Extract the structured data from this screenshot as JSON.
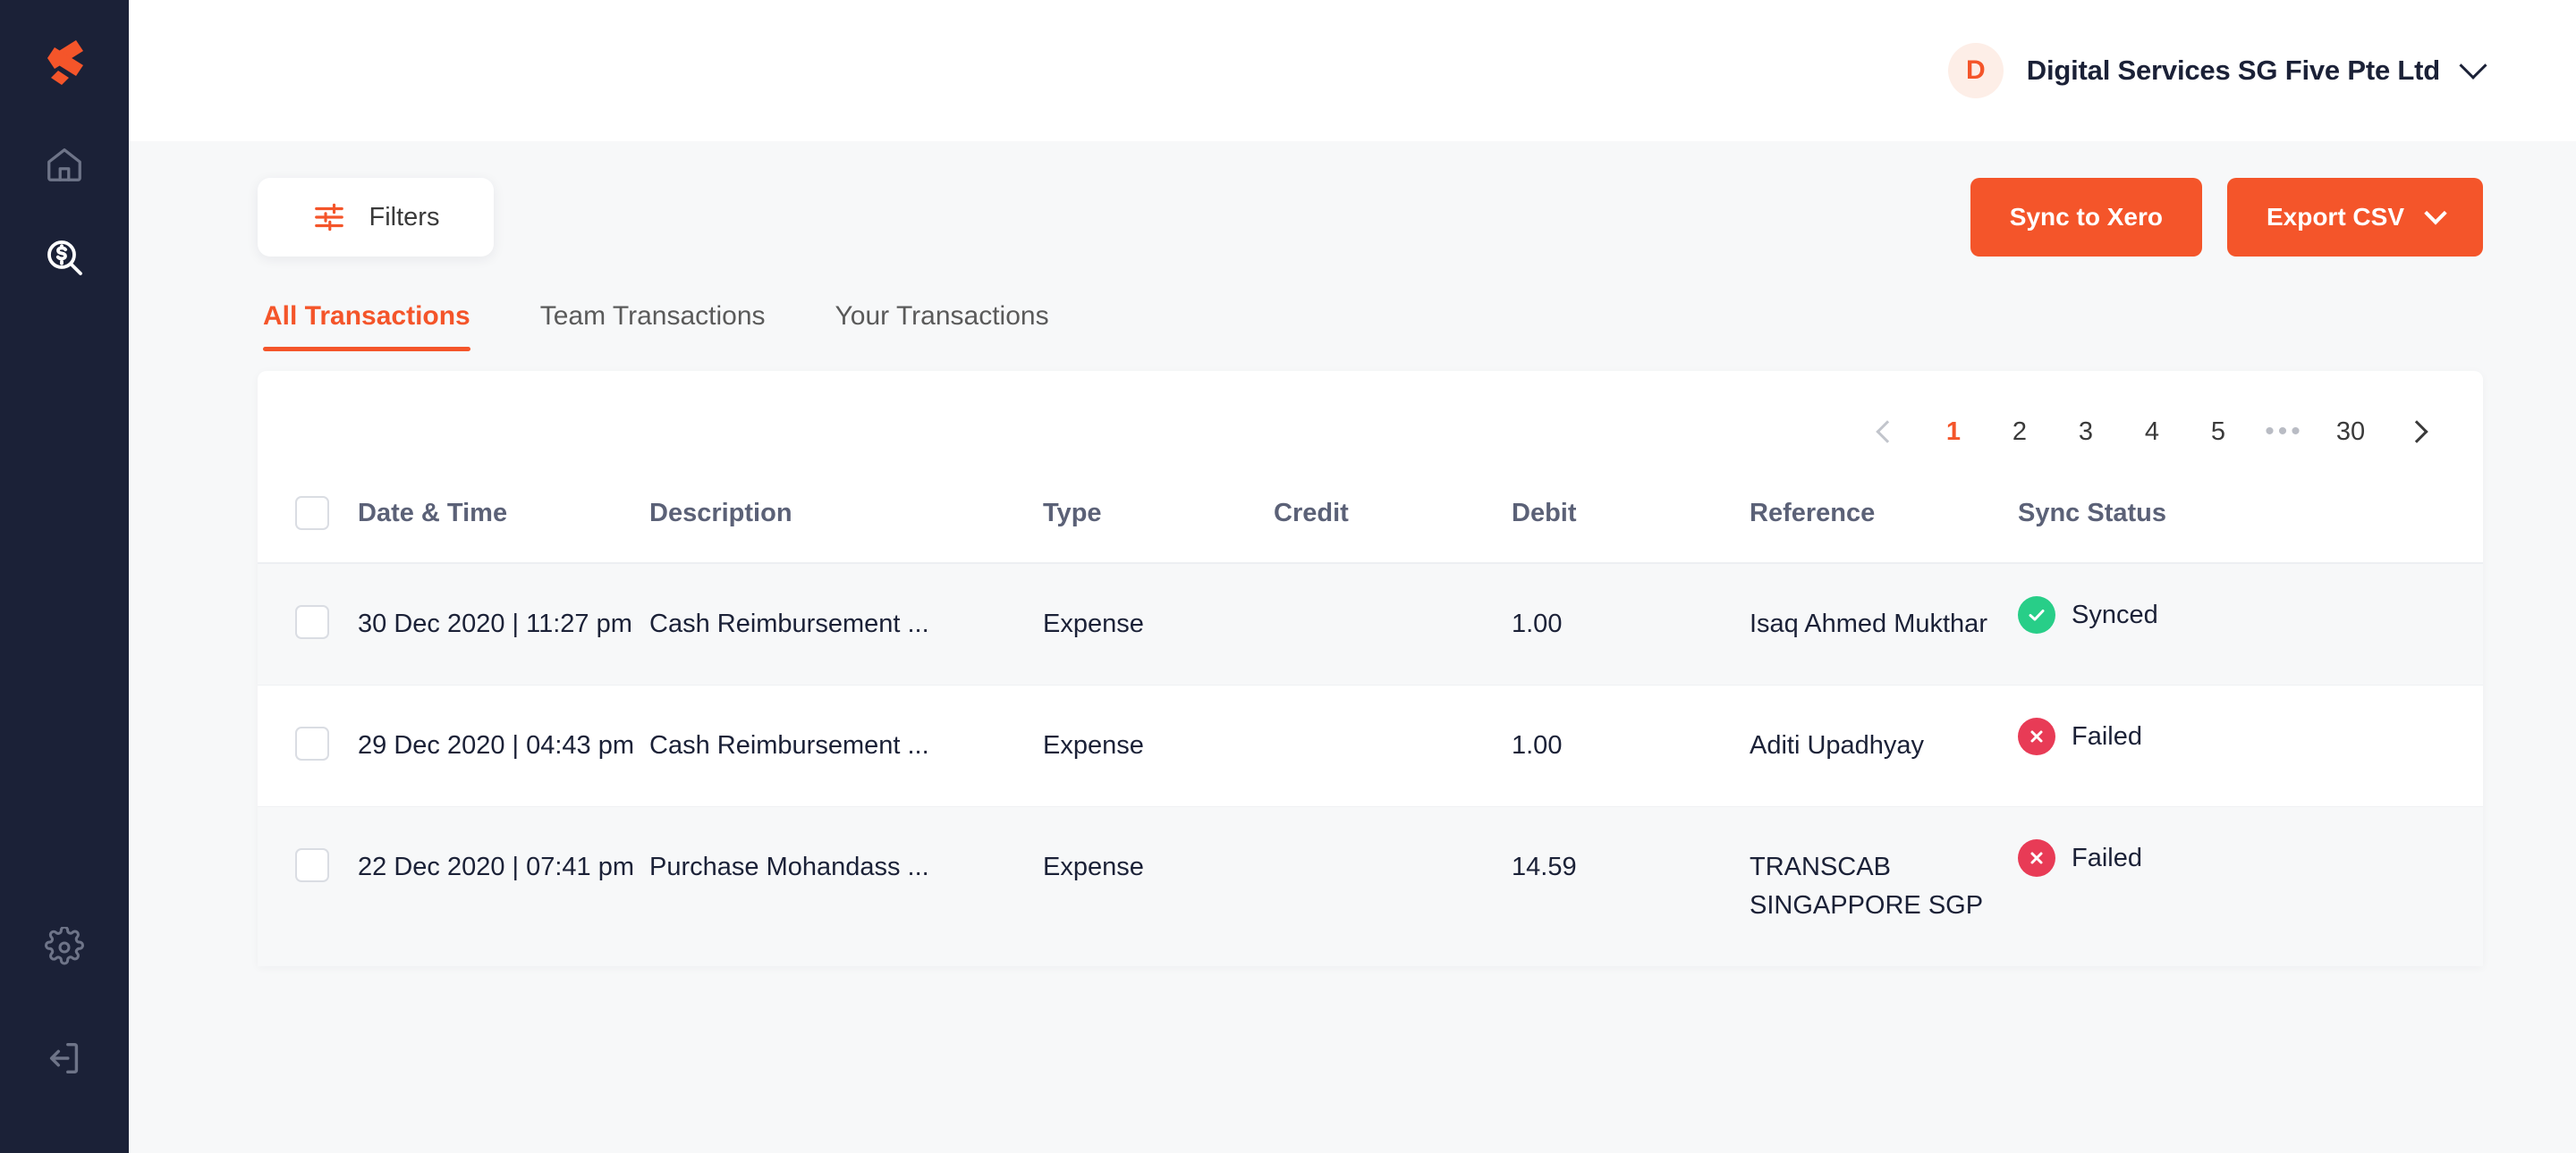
{
  "brand": {
    "logo_name": "spenmo-logo",
    "accent": "#F4552A",
    "sidebar_bg": "#1B2137"
  },
  "sidebar": {
    "items": [
      {
        "name": "home-icon",
        "label": "Home"
      },
      {
        "name": "transactions-icon",
        "label": "Transactions"
      }
    ],
    "bottom_items": [
      {
        "name": "gear-icon",
        "label": "Settings"
      },
      {
        "name": "logout-icon",
        "label": "Logout"
      }
    ]
  },
  "header": {
    "avatar_initial": "D",
    "org_name": "Digital Services SG Five Pte Ltd"
  },
  "toolbar": {
    "filters_label": "Filters",
    "sync_label": "Sync to Xero",
    "export_label": "Export CSV"
  },
  "tabs": [
    {
      "label": "All Transactions",
      "active": true
    },
    {
      "label": "Team Transactions",
      "active": false
    },
    {
      "label": "Your Transactions",
      "active": false
    }
  ],
  "pagination": {
    "pages": [
      "1",
      "2",
      "3",
      "4",
      "5"
    ],
    "dots": "•••",
    "last_page": "30",
    "current": "1"
  },
  "table": {
    "columns": [
      "Date & Time",
      "Description",
      "Type",
      "Credit",
      "Debit",
      "Reference",
      "Sync Status"
    ],
    "rows": [
      {
        "datetime": "30 Dec 2020 | 11:27 pm",
        "description": "Cash Reimbursement ...",
        "type": "Expense",
        "credit": "",
        "debit": "1.00",
        "reference": "Isaq Ahmed Mukthar",
        "sync_status": "Synced",
        "sync_state": "synced"
      },
      {
        "datetime": "29 Dec 2020 | 04:43 pm",
        "description": "Cash Reimbursement ...",
        "type": "Expense",
        "credit": "",
        "debit": "1.00",
        "reference": "Aditi Upadhyay",
        "sync_status": "Failed",
        "sync_state": "failed"
      },
      {
        "datetime": "22 Dec 2020 | 07:41 pm",
        "description": "Purchase Mohandass ...",
        "type": "Expense",
        "credit": "",
        "debit": "14.59",
        "reference": "TRANSCAB SINGAPPORE SGP",
        "sync_status": "Failed",
        "sync_state": "failed"
      }
    ]
  },
  "status_colors": {
    "synced": "#28CE88",
    "failed": "#E83B56"
  }
}
